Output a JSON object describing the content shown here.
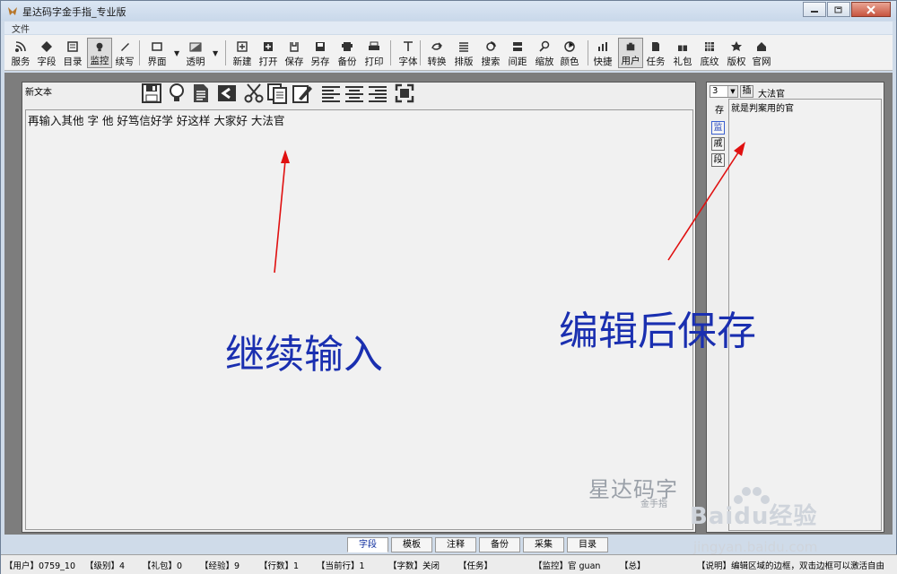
{
  "window": {
    "title": "星达码字金手指_专业版"
  },
  "menu": {
    "items": [
      "文件"
    ]
  },
  "toolbar": {
    "items": [
      {
        "label": "服务",
        "icon": "rss-icon"
      },
      {
        "label": "字段",
        "icon": "diamond-icon"
      },
      {
        "label": "目录",
        "icon": "list-icon"
      },
      {
        "label": "监控",
        "icon": "monitor-icon",
        "pressed": true
      },
      {
        "label": "续写",
        "icon": "pen-icon"
      },
      {
        "label": "界面",
        "icon": "window-icon",
        "dropdown": true
      },
      {
        "label": "透明",
        "icon": "transparency-icon",
        "dropdown": true
      },
      {
        "label": "新建",
        "icon": "new-icon"
      },
      {
        "label": "打开",
        "icon": "open-icon"
      },
      {
        "label": "保存",
        "icon": "save-icon"
      },
      {
        "label": "另存",
        "icon": "save-as-icon"
      },
      {
        "label": "备份",
        "icon": "backup-icon"
      },
      {
        "label": "打印",
        "icon": "print-icon"
      },
      {
        "label": "字体",
        "icon": "font-icon"
      },
      {
        "label": "转换",
        "icon": "convert-icon"
      },
      {
        "label": "排版",
        "icon": "layout-icon"
      },
      {
        "label": "搜索",
        "icon": "search-icon"
      },
      {
        "label": "间距",
        "icon": "spacing-icon"
      },
      {
        "label": "缩放",
        "icon": "zoom-icon"
      },
      {
        "label": "颜色",
        "icon": "color-icon"
      },
      {
        "label": "快捷",
        "icon": "shortcut-icon"
      },
      {
        "label": "用户",
        "icon": "user-icon",
        "pressed": true
      },
      {
        "label": "任务",
        "icon": "task-icon"
      },
      {
        "label": "礼包",
        "icon": "gift-icon"
      },
      {
        "label": "底纹",
        "icon": "texture-icon"
      },
      {
        "label": "版权",
        "icon": "star-icon"
      },
      {
        "label": "官网",
        "icon": "home-icon"
      }
    ]
  },
  "editor": {
    "doc_name": "新文本",
    "content": "再输入其他 字 他 好笃信好学 好这样 大家好 大法官",
    "tools": [
      "save-icon",
      "lightbulb-icon",
      "document-icon",
      "back-arrow-icon",
      "scissors-icon",
      "copy-icon",
      "edit-icon",
      "align-left-icon",
      "align-center-icon",
      "align-right-icon",
      "fullscreen-icon"
    ]
  },
  "right_panel": {
    "combo_value": "3",
    "insert_label": "插",
    "word": "大法官",
    "save_label": "存",
    "side_buttons": [
      "监",
      "戚",
      "段"
    ],
    "definition": "就是判案用的官"
  },
  "annotations": {
    "left": "继续输入",
    "right": "编辑后保存"
  },
  "watermark": {
    "main": "星达码字",
    "sub": "金手指"
  },
  "baidu": {
    "brand": "Baidu经验",
    "url": "jingyan.baidu.com"
  },
  "tabs": [
    "字段",
    "模板",
    "注释",
    "备份",
    "采集",
    "目录"
  ],
  "active_tab": "字段",
  "status": {
    "user": "【用户】0759_10",
    "level": "【级别】4",
    "gift": "【礼包】0",
    "exp": "【经验】9",
    "lines": "【行数】1",
    "current_line": "【当前行】1",
    "chars": "【字数】关闭",
    "task": "【任务】",
    "monitor": "【监控】官 guan",
    "total": "【总】",
    "note": "【说明】编辑区域的边框，双击边框可以激活自由"
  },
  "colors": {
    "annotation": "#1a2fb0",
    "arrow": "#e01010",
    "workspace": "#7d7d7d"
  }
}
